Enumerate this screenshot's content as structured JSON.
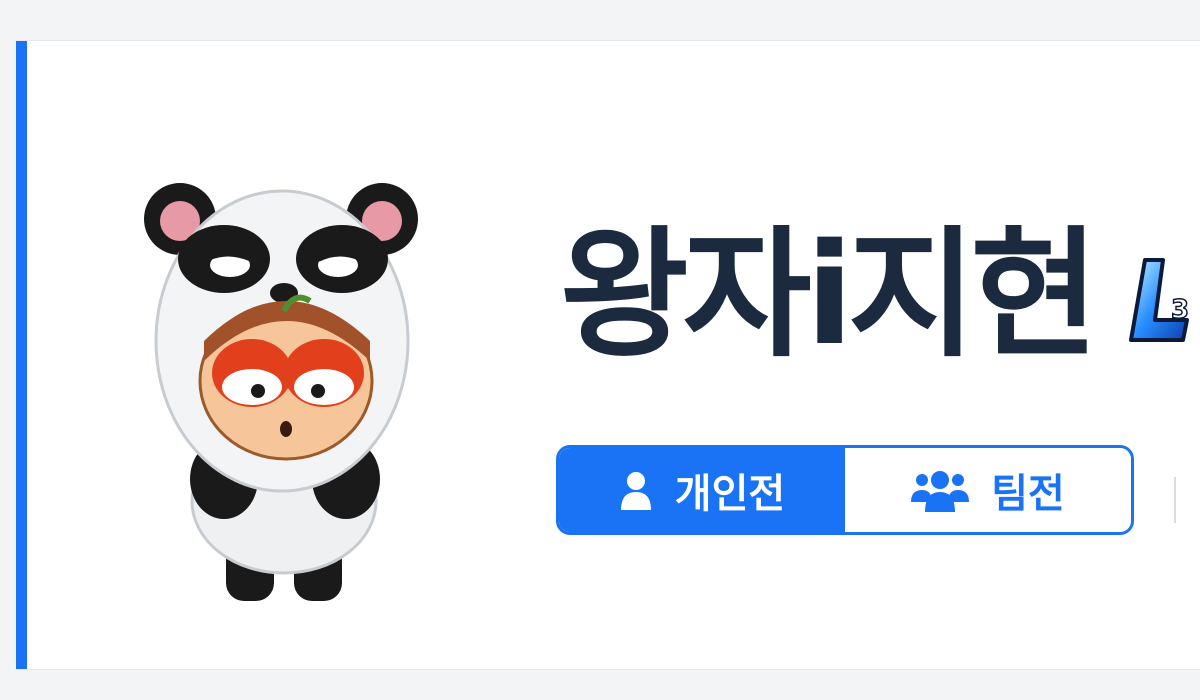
{
  "profile": {
    "nickname": "왕자i지현",
    "avatar_icon": "panda-costume-character",
    "level_badge_icon": "level-badge-L3",
    "level_badge_text": "L3"
  },
  "mode_toggle": {
    "options": [
      {
        "label": "개인전",
        "icon": "single-user-icon",
        "selected": true
      },
      {
        "label": "팀전",
        "icon": "team-users-icon",
        "selected": false
      }
    ]
  },
  "colors": {
    "accent": "#1a73f5",
    "nickname": "#1b2a3f",
    "card_background": "#ffffff",
    "page_background": "#f3f4f6"
  }
}
